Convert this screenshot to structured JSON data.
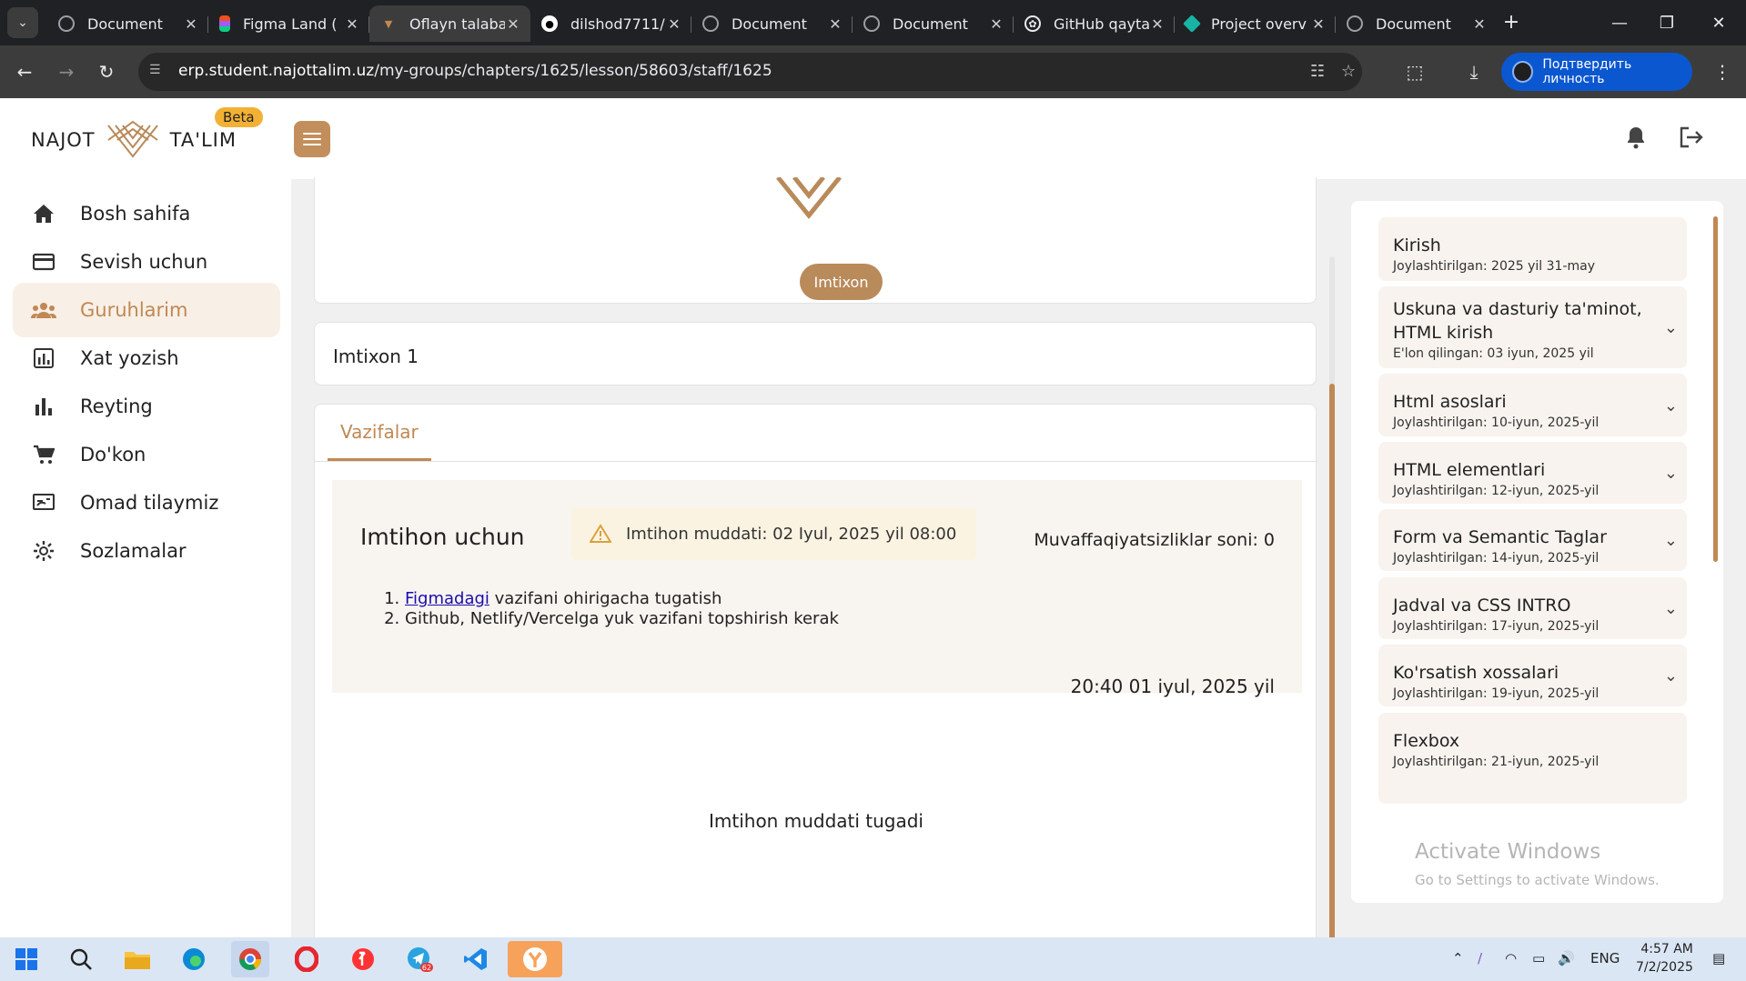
{
  "browser": {
    "tabs": [
      {
        "title": "Document",
        "icon": "globe-icon",
        "active": false
      },
      {
        "title": "Figma Land (",
        "icon": "figma-icon",
        "active": false
      },
      {
        "title": "Oflayn talaba",
        "icon": "najot-icon",
        "active": true
      },
      {
        "title": "dilshod7711/",
        "icon": "github-icon",
        "active": false
      },
      {
        "title": "Document",
        "icon": "globe-icon",
        "active": false
      },
      {
        "title": "Document",
        "icon": "globe-icon",
        "active": false
      },
      {
        "title": "GitHub qayta",
        "icon": "chatgpt-icon",
        "active": false
      },
      {
        "title": "Project overv",
        "icon": "diamond-icon",
        "active": false
      },
      {
        "title": "Document",
        "icon": "globe-icon",
        "active": false
      }
    ],
    "url_host": "erp.student.najottalim.uz",
    "url_path": "/my-groups/chapters/1625/lesson/58603/staff/1625",
    "verify_label": "Подтвердить личность"
  },
  "header": {
    "logo_left": "NAJOT",
    "logo_right": "TA'LIM",
    "beta": "Beta"
  },
  "sidebar": {
    "items": [
      {
        "label": "Bosh sahifa",
        "icon": "home-icon"
      },
      {
        "label": "Sevish uchun",
        "icon": "card-icon"
      },
      {
        "label": "Guruhlarim",
        "icon": "groups-icon",
        "active": true
      },
      {
        "label": "Xat yozish",
        "icon": "chart-box-icon"
      },
      {
        "label": "Reyting",
        "icon": "bar-chart-icon"
      },
      {
        "label": "Do'kon",
        "icon": "cart-icon"
      },
      {
        "label": "Omad tilaymiz",
        "icon": "school-icon"
      },
      {
        "label": "Sozlamalar",
        "icon": "gear-icon"
      }
    ]
  },
  "main": {
    "badge": "Imtixon",
    "exam_title": "Imtixon 1",
    "tab_label": "Vazifalar",
    "task": {
      "heading": "Imtihon uchun",
      "deadline": "Imtihon muddati: 02 Iyul, 2025 yil 08:00",
      "fails": "Muvaffaqiyatsizliklar soni: 0",
      "item1_link": "Figmadagi",
      "item1_rest": " vazifani ohirigacha tugatish",
      "item2": "Github, Netlify/Vercelga yuk vazifani topshirish kerak",
      "date": "20:40 01 iyul, 2025 yil"
    },
    "expired": "Imtihon muddati tugadi"
  },
  "lessons": [
    {
      "title": "Kirish",
      "date": "Joylashtirilgan: 2025 yil 31-may",
      "expandable": false
    },
    {
      "title": "Uskuna va dasturiy ta'minot, HTML kirish",
      "date": "E'lon qilingan: 03 iyun, 2025 yil",
      "expandable": true
    },
    {
      "title": "Html asoslari",
      "date": "Joylashtirilgan: 10-iyun, 2025-yil",
      "expandable": true
    },
    {
      "title": "HTML elementlari",
      "date": "Joylashtirilgan: 12-iyun, 2025-yil",
      "expandable": true
    },
    {
      "title": "Form va Semantic Taglar",
      "date": "Joylashtirilgan: 14-iyun, 2025-yil",
      "expandable": true
    },
    {
      "title": "Jadval va CSS INTRO",
      "date": "Joylashtirilgan: 17-iyun, 2025-yil",
      "expandable": true
    },
    {
      "title": "Ko'rsatish xossalari",
      "date": "Joylashtirilgan: 19-iyun, 2025-yil",
      "expandable": true
    },
    {
      "title": "Flexbox",
      "date": "Joylashtirilgan: 21-iyun, 2025-yil",
      "expandable": false
    }
  ],
  "watermark": {
    "line1": "Activate Windows",
    "line2": "Go to Settings to activate Windows."
  },
  "taskbar": {
    "lang": "ENG",
    "time": "4:57 AM",
    "date": "7/2/2025",
    "telegram_badge": "62"
  },
  "colors": {
    "accent": "#c08854",
    "accent_soft": "#f8efe6",
    "chrome_dark": "#202124",
    "blue_button": "#0b57d0"
  }
}
